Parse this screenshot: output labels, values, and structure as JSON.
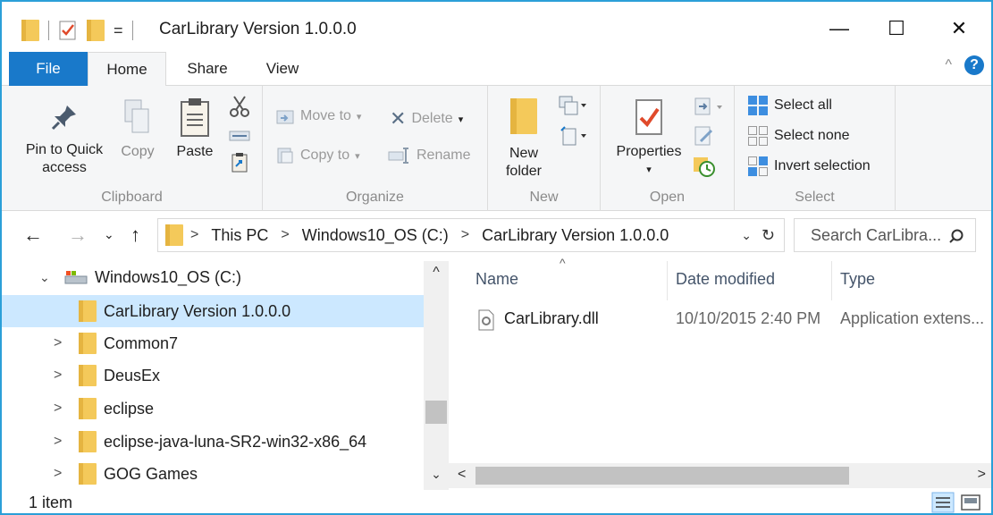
{
  "window": {
    "title": "CarLibrary Version 1.0.0.0",
    "accent": "#1979ca",
    "border_color": "#2b9fd8"
  },
  "titlebar": {
    "qat_dropdown": "=",
    "minimize": "—",
    "maximize": "☐",
    "close": "✕"
  },
  "tabs": {
    "file": "File",
    "home": "Home",
    "share": "Share",
    "view": "View",
    "collapse_glyph": "^",
    "help": "?"
  },
  "ribbon": {
    "clipboard": {
      "label": "Clipboard",
      "pin_line1": "Pin to Quick",
      "pin_line2": "access",
      "copy": "Copy",
      "paste": "Paste"
    },
    "organize": {
      "label": "Organize",
      "move_to": "Move to",
      "copy_to": "Copy to",
      "delete": "Delete",
      "rename": "Rename"
    },
    "new": {
      "label": "New",
      "new_folder_line1": "New",
      "new_folder_line2": "folder"
    },
    "open": {
      "label": "Open",
      "properties": "Properties"
    },
    "select": {
      "label": "Select",
      "select_all": "Select all",
      "select_none": "Select none",
      "invert_selection": "Invert selection"
    }
  },
  "address": {
    "crumbs": [
      "This PC",
      "Windows10_OS (C:)",
      "CarLibrary Version 1.0.0.0"
    ],
    "search_placeholder": "Search CarLibra..."
  },
  "tree": {
    "drive": "Windows10_OS (C:)",
    "items": [
      {
        "label": "CarLibrary Version 1.0.0.0",
        "selected": true
      },
      {
        "label": "Common7"
      },
      {
        "label": "DeusEx"
      },
      {
        "label": "eclipse"
      },
      {
        "label": "eclipse-java-luna-SR2-win32-x86_64"
      },
      {
        "label": "GOG Games"
      }
    ]
  },
  "columns": {
    "name": "Name",
    "date_modified": "Date modified",
    "type": "Type"
  },
  "files": [
    {
      "name": "CarLibrary.dll",
      "date_modified": "10/10/2015 2:40 PM",
      "type": "Application extens..."
    }
  ],
  "status": {
    "item_count": "1 item"
  }
}
